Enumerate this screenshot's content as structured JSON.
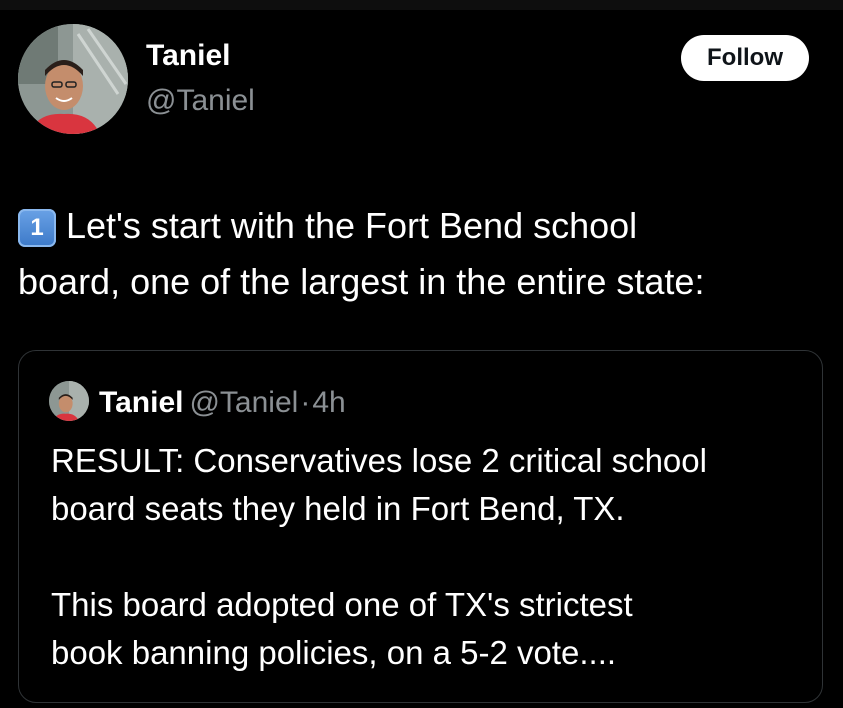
{
  "author": {
    "display_name": "Taniel",
    "handle": "@Taniel",
    "avatar_icon": "profile-photo"
  },
  "follow_label": "Follow",
  "tweet": {
    "number_emoji": "1",
    "text_line1": "Let's start with the Fort Bend school",
    "text_line2": "board, one of the largest in the entire state:"
  },
  "quoted": {
    "display_name": "Taniel",
    "handle": "@Taniel",
    "separator": "·",
    "time": "4h",
    "paragraph1_line1": "RESULT: Conservatives lose 2 critical school",
    "paragraph1_line2": "board seats they held in Fort Bend, TX.",
    "paragraph2_line1": "This board adopted one of TX's strictest",
    "paragraph2_line2": "book banning policies, on a 5-2 vote...."
  },
  "colors": {
    "background": "#000000",
    "text": "#ffffff",
    "secondary_text": "#8b9094",
    "border": "#2f3336",
    "follow_bg": "#ffffff",
    "keycap_blue": "#4a86d4"
  }
}
